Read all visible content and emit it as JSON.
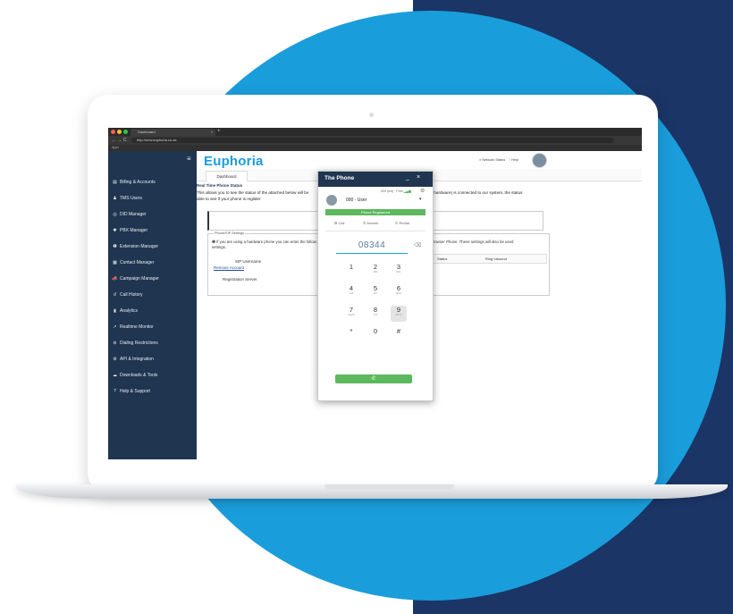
{
  "colors": {
    "navy": "#1b3566",
    "circle_blue": "#1a9ddb",
    "sidebar": "#1f3550",
    "accent_green": "#5cb85c"
  },
  "browser": {
    "tab_title": "Dashboard",
    "tab_close": "×",
    "tab_add": "+",
    "nav_back": "←",
    "nav_forward": "→",
    "nav_reload": "C",
    "url": "http://new.euphoria.co.za",
    "bookmarks_label": "Apps"
  },
  "sidebar": {
    "menu_icon": "hamburger-icon",
    "items": [
      {
        "label": "Billing & Accounts",
        "icon": "▤"
      },
      {
        "label": "TMS Users",
        "icon": "♟"
      },
      {
        "label": "DID Manager",
        "icon": "◎"
      },
      {
        "label": "PBX Manager",
        "icon": "✱"
      },
      {
        "label": "Extension Manager",
        "icon": "❶"
      },
      {
        "label": "Contact Manager",
        "icon": "▦"
      },
      {
        "label": "Campaign Manager",
        "icon": "📣"
      },
      {
        "label": "Call History",
        "icon": "↺"
      },
      {
        "label": "Analytics",
        "icon": "▮"
      },
      {
        "label": "Realtime Monitor",
        "icon": "↗"
      },
      {
        "label": "Dialing Restrictions",
        "icon": "⊘"
      },
      {
        "label": "API & Integration",
        "icon": "⚙"
      },
      {
        "label": "Downloads & Tools",
        "icon": "☁"
      },
      {
        "label": "Help & Support",
        "icon": "?"
      }
    ]
  },
  "header": {
    "logo": "Euphoria",
    "network_status": "Network Status",
    "help": "Help"
  },
  "tabs": {
    "dashboard": "Dashboard"
  },
  "content": {
    "section_title": "Real Time Phone Status",
    "intro_left": "This allows you to see the status of the attached below will be able to see if your phone is register",
    "intro_right": "or hardware) is connected to our system, the status",
    "fieldset_legend": "Phone/SIP Settings",
    "fieldset_text": "If you are using a hardware phone you can enter the follow SIP settings.",
    "fieldset_right_text": "Browser Phone. These settings will also be used",
    "sip_username_label": "SIP Username",
    "remove_account": "Remove Account",
    "registration_server_label": "Registration Server",
    "table_headers": {
      "status": "Status",
      "ring_inbound": "Ring Inbound"
    }
  },
  "phone": {
    "title": "The Phone",
    "minimize": "_",
    "close": "×",
    "extension_info": "000 (ext) · Free",
    "user_label": "000 · User",
    "registered": "Phone Registered",
    "actions": {
      "call": "Call",
      "answer": "Answer",
      "redial": "Redial"
    },
    "number": "08344",
    "clear_icon": "⌫",
    "call_icon": "✆",
    "keys": [
      {
        "d": "1",
        "l": ""
      },
      {
        "d": "2",
        "l": "ABC"
      },
      {
        "d": "3",
        "l": "DEF"
      },
      {
        "d": "4",
        "l": "GHI"
      },
      {
        "d": "5",
        "l": "JKL"
      },
      {
        "d": "6",
        "l": "MNO"
      },
      {
        "d": "7",
        "l": "PQRS"
      },
      {
        "d": "8",
        "l": "TUV"
      },
      {
        "d": "9",
        "l": "WXYZ"
      },
      {
        "d": "*",
        "l": ""
      },
      {
        "d": "0",
        "l": ""
      },
      {
        "d": "#",
        "l": ""
      }
    ]
  }
}
